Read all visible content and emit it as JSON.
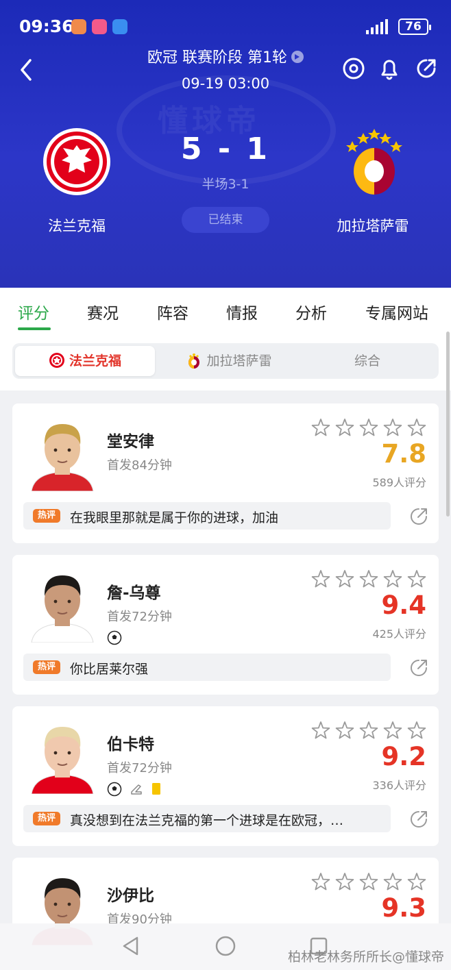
{
  "status_bar": {
    "time": "09:36",
    "battery": "76"
  },
  "match": {
    "title": "欧冠 联赛阶段 第1轮",
    "date": "09-19 03:00",
    "score": "5 - 1",
    "halftime": "半场3-1",
    "status": "已结束",
    "home_team": "法兰克福",
    "away_team": "加拉塔萨雷",
    "watermark": "懂球帝"
  },
  "tabs": [
    "评分",
    "赛况",
    "阵容",
    "情报",
    "分析",
    "专属网站"
  ],
  "active_tab": "评分",
  "segments": {
    "home": "法兰克福",
    "away": "加拉塔萨雷",
    "overall": "综合"
  },
  "colors": {
    "header": "#2c36c8",
    "accent_green": "#2ca84a",
    "rating_red": "#e53426",
    "rating_gold": "#e8a623",
    "hot_tag": "#f07a2a"
  },
  "players": [
    {
      "name": "堂安律",
      "meta": "首发84分钟",
      "rating": "7.8",
      "rating_color": "gold",
      "count": "589人评分",
      "hot_label": "热评",
      "comment": "在我眼里那就是属于你的进球，加油",
      "events": []
    },
    {
      "name": "詹-乌尊",
      "meta": "首发72分钟",
      "rating": "9.4",
      "rating_color": "red",
      "count": "425人评分",
      "hot_label": "热评",
      "comment": "你比居莱尔强",
      "events": [
        "goal-icon"
      ]
    },
    {
      "name": "伯卡特",
      "meta": "首发72分钟",
      "rating": "9.2",
      "rating_color": "red",
      "count": "336人评分",
      "hot_label": "热评",
      "comment": "真没想到在法兰克福的第一个进球是在欧冠，…",
      "events": [
        "goal-icon",
        "assist-boot-icon",
        "yellow-card-icon"
      ]
    },
    {
      "name": "沙伊比",
      "meta": "首发90分钟",
      "rating": "9.3",
      "rating_color": "red",
      "count": "",
      "hot_label": "",
      "comment": "",
      "events": []
    }
  ],
  "credit": "柏林老林务所所长@懂球帝"
}
